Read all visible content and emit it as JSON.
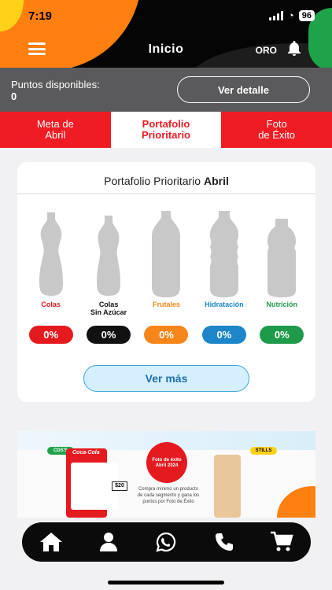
{
  "status_bar": {
    "time": "7:19",
    "battery": "96"
  },
  "header": {
    "title": "Inicio",
    "level": "ORO"
  },
  "points": {
    "label": "Puntos disponibles:",
    "value": "0",
    "detail_button": "Ver detalle"
  },
  "tabs": [
    {
      "label": "Meta de\nAbril",
      "active": false
    },
    {
      "label": "Portafolio\nPrioritario",
      "active": true
    },
    {
      "label": "Foto\nde Éxito",
      "active": false
    }
  ],
  "portfolio": {
    "title": "Portafolio Prioritario",
    "title_month": "Abril",
    "categories": [
      {
        "label": "Colas",
        "percent": "0%",
        "color": "#e51a1f"
      },
      {
        "label": "Colas\nSin Azúcar",
        "percent": "0%",
        "color": "#111111"
      },
      {
        "label": "Frutales",
        "percent": "0%",
        "color": "#f7861a"
      },
      {
        "label": "Hidratación",
        "percent": "0%",
        "color": "#1c86c8"
      },
      {
        "label": "Nutrición",
        "percent": "0%",
        "color": "#1f9a4b"
      }
    ],
    "more_button": "Ver más"
  },
  "banner": {
    "badge_left": "CDS'S",
    "badge_right": "STILLS",
    "brand": "Coca-Cola",
    "price": "$20",
    "circle_text": "Foto de éxito\nAbril 2024",
    "promo": "Compra mínimo un producto de cada segmento y gana los puntos por Foto de Éxito"
  },
  "nav": [
    {
      "name": "home",
      "icon": "home-icon"
    },
    {
      "name": "profile",
      "icon": "user-icon"
    },
    {
      "name": "whatsapp",
      "icon": "whatsapp-icon"
    },
    {
      "name": "phone",
      "icon": "phone-icon"
    },
    {
      "name": "cart",
      "icon": "cart-icon"
    }
  ],
  "colors": {
    "brand_red": "#f01c24",
    "dark": "#050505",
    "grey_bar": "#5a5a5c",
    "accent_blue": "#1f6fab"
  }
}
